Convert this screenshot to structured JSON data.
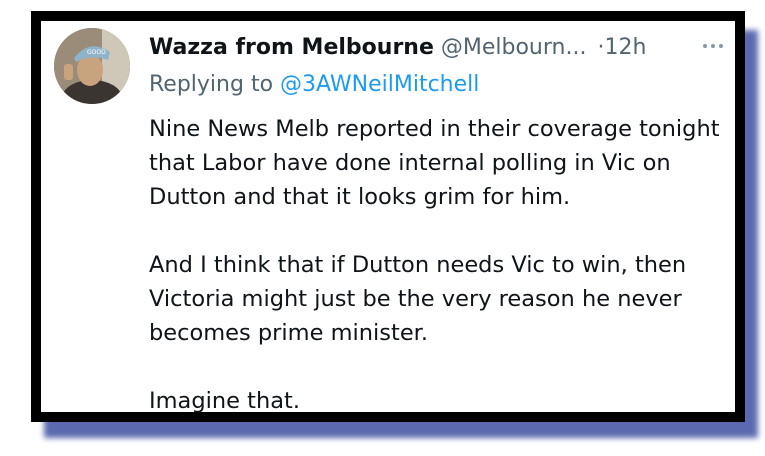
{
  "tweet": {
    "display_name": "Wazza from Melbourne",
    "handle": "@Melbourn...",
    "separator": "·",
    "time": "12h",
    "more_icon": "more-horizontal-icon",
    "reply_prefix": "Replying to ",
    "reply_to": "@3AWNeilMitchell",
    "paragraphs": [
      "Nine News Melb reported in their coverage tonight that Labor have done internal polling in Vic on Dutton and that it looks grim for him.",
      "And I think that if Dutton needs Vic to win, then Victoria might just be the very reason he never becomes prime minister.",
      "Imagine that."
    ]
  },
  "colors": {
    "frame": "#000000",
    "shadow": "#4a5aa8",
    "name": "#0f1419",
    "muted": "#536471",
    "link": "#1d9bf0"
  }
}
